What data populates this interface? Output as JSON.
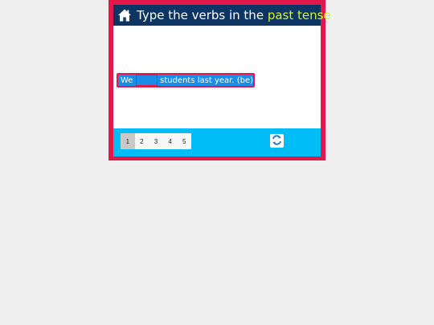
{
  "header": {
    "title_prefix": "Type the verbs in the ",
    "title_highlight": "past tense",
    "title_suffix": "."
  },
  "exercise": {
    "before_blank": "We",
    "blank_value": "",
    "after_blank": "students last year. (be)"
  },
  "pagination": {
    "pages": [
      "1",
      "2",
      "3",
      "4",
      "5"
    ],
    "active": "1"
  },
  "colors": {
    "frame": "#e2174a",
    "header": "#0d3564",
    "highlight": "#d6f02a",
    "sentence": "#1a8ee6",
    "footer": "#00bdf7"
  },
  "icons": {
    "home": "home-icon",
    "refresh": "refresh-icon"
  }
}
